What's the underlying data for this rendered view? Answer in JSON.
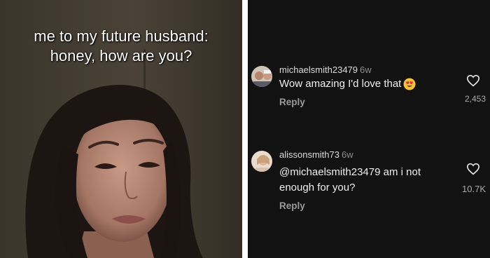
{
  "meme": {
    "caption_line1": "me to my future husband:",
    "caption_line2": "honey, how are you?"
  },
  "comments": [
    {
      "username": "michaelsmith23479",
      "age": "6w",
      "text": "Wow amazing I'd love that",
      "emoji": "heart-eyes-emoji",
      "reply_label": "Reply",
      "likes": "2,453"
    },
    {
      "username": "alissonsmith73",
      "age": "6w",
      "text_line1": "@michaelsmith23479 am i not",
      "text_line2": "enough for  you?",
      "reply_label": "Reply",
      "likes": "10.7K"
    }
  ],
  "colors": {
    "comments_bg": "#121212",
    "username": "#dcdcdc",
    "muted": "#8e8e8e"
  }
}
